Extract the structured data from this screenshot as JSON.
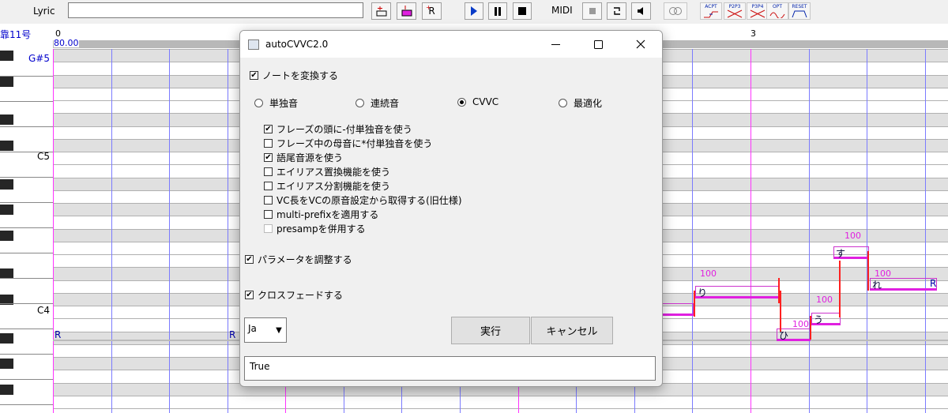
{
  "toolbar": {
    "lyric_label": "Lyric",
    "lyric_value": "",
    "midi_label": "MIDI",
    "button_r_label": "R",
    "icons": [
      "insert-note-icon",
      "insert-pink-icon",
      "insert-rest-icon",
      "play-icon",
      "pause-icon",
      "stop-icon",
      "midi-record-icon",
      "loop-icon",
      "speaker-icon",
      "overlap-icon",
      "acpt-icon",
      "p2p3-icon",
      "p3p4-icon",
      "opt-icon",
      "reset-icon"
    ],
    "preset_labels": [
      "ACPT",
      "P2P3",
      "P3P4",
      "OPT",
      "RESET"
    ]
  },
  "piano_roll": {
    "track_label": "靠11号",
    "ruler_start": "0",
    "tempo": "80.00",
    "ruler_mark": "3",
    "key_labels": [
      "G#5",
      "C5",
      "C4"
    ],
    "rest_labels": [
      "R",
      "R",
      "R"
    ],
    "notes": [
      {
        "lyric": "り",
        "velocity": "100"
      },
      {
        "lyric": "ひ",
        "velocity": "100"
      },
      {
        "lyric": "う",
        "velocity": "100"
      },
      {
        "lyric": "す",
        "velocity": "100"
      },
      {
        "lyric": "れ",
        "velocity": "100"
      }
    ]
  },
  "dialog": {
    "title": "autoCVVC2.0",
    "convert_notes": {
      "label": "ノートを変換する",
      "checked": true
    },
    "modes": [
      {
        "label": "単独音",
        "selected": false
      },
      {
        "label": "連続音",
        "selected": false
      },
      {
        "label": "CVVC",
        "selected": true
      },
      {
        "label": "最適化",
        "selected": false
      }
    ],
    "options": [
      {
        "label": "フレーズの頭に-付単独音を使う",
        "checked": true
      },
      {
        "label": "フレーズ中の母音に*付単独音を使う",
        "checked": false
      },
      {
        "label": "語尾音源を使う",
        "checked": true
      },
      {
        "label": "エイリアス置換機能を使う",
        "checked": false
      },
      {
        "label": "エイリアス分割機能を使う",
        "checked": false
      },
      {
        "label": "VC長をVCの原音設定から取得する(旧仕様)",
        "checked": false
      },
      {
        "label": "multi-prefixを適用する",
        "checked": false
      },
      {
        "label": "presampを併用する",
        "checked": false
      }
    ],
    "adjust_params": {
      "label": "パラメータを調整する",
      "checked": true
    },
    "crossfade": {
      "label": "クロスフェードする",
      "checked": true
    },
    "language": "Ja",
    "run_label": "実行",
    "cancel_label": "キャンセル",
    "status_text": "True",
    "check_mark": "✔"
  }
}
